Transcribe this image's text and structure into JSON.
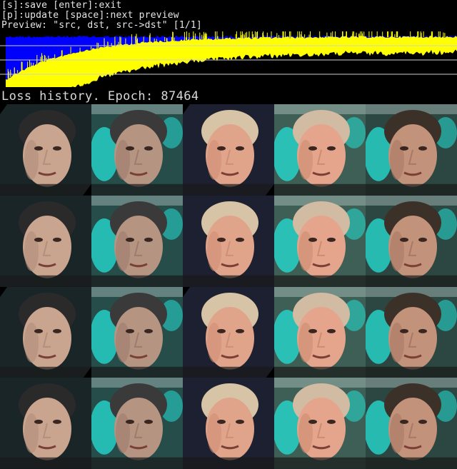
{
  "header": {
    "line1": "[s]:save [enter]:exit",
    "line2": "[p]:update [space]:next preview",
    "line3": "Preview: \"src, dst, src->dst\" [1/1]"
  },
  "loss_graph": {
    "label": "Loss history. Epoch: 87464",
    "series": [
      {
        "name": "",
        "color": "#0000ff"
      },
      {
        "name": "",
        "color": "#ffff00"
      }
    ],
    "grid_lines": true
  },
  "preview": {
    "rows": [
      [
        "src-face",
        "src-reconstruction",
        "dst-face",
        "dst-reconstruction",
        "src-to-dst-swap"
      ],
      [
        "src-face",
        "src-reconstruction",
        "dst-face",
        "dst-reconstruction",
        "src-to-dst-swap"
      ],
      [
        "src-face",
        "src-reconstruction",
        "dst-face",
        "dst-reconstruction",
        "src-to-dst-swap"
      ],
      [
        "src-face",
        "src-reconstruction",
        "dst-face",
        "dst-reconstruction",
        "src-to-dst-swap"
      ]
    ]
  },
  "colors": {
    "background": "#000000",
    "text": "#e6e6e6",
    "graph_blue": "#0000ff",
    "graph_yellow": "#ffff00",
    "artifact_cyan": "#25e0d5"
  }
}
